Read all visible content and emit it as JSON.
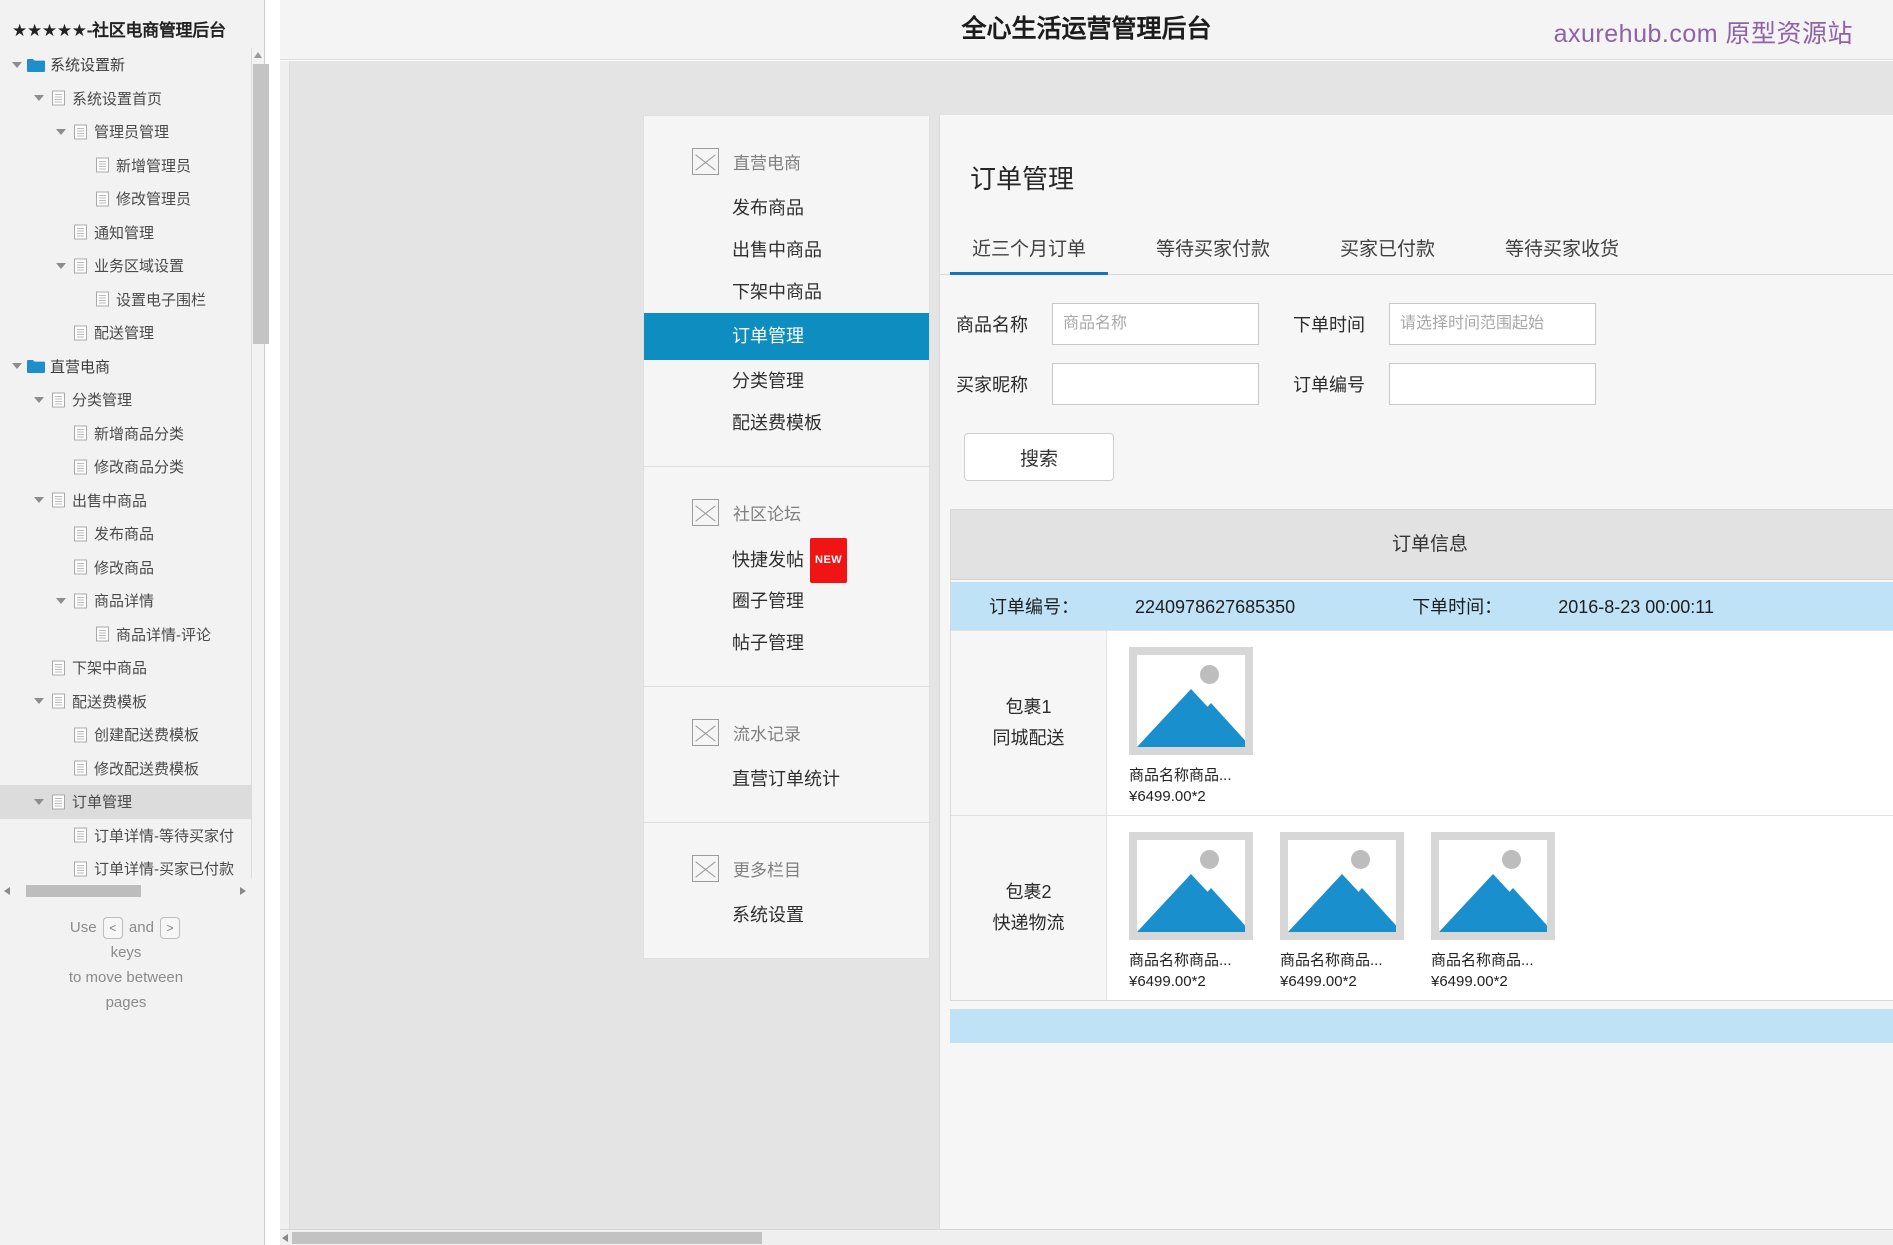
{
  "sitemap": {
    "title": "★★★★★-社区电商管理后台",
    "nodes": [
      {
        "label": "系统设置新",
        "depth": 0,
        "type": "folder",
        "caret": true
      },
      {
        "label": "系统设置首页",
        "depth": 1,
        "type": "page",
        "caret": true
      },
      {
        "label": "管理员管理",
        "depth": 2,
        "type": "page",
        "caret": true
      },
      {
        "label": "新增管理员",
        "depth": 3,
        "type": "page",
        "caret": false
      },
      {
        "label": "修改管理员",
        "depth": 3,
        "type": "page",
        "caret": false
      },
      {
        "label": "通知管理",
        "depth": 2,
        "type": "page",
        "caret": false
      },
      {
        "label": "业务区域设置",
        "depth": 2,
        "type": "page",
        "caret": true
      },
      {
        "label": "设置电子围栏",
        "depth": 3,
        "type": "page",
        "caret": false
      },
      {
        "label": "配送管理",
        "depth": 2,
        "type": "page",
        "caret": false
      },
      {
        "label": "直营电商",
        "depth": 0,
        "type": "folder",
        "caret": true
      },
      {
        "label": "分类管理",
        "depth": 1,
        "type": "page",
        "caret": true
      },
      {
        "label": "新增商品分类",
        "depth": 2,
        "type": "page",
        "caret": false
      },
      {
        "label": "修改商品分类",
        "depth": 2,
        "type": "page",
        "caret": false
      },
      {
        "label": "出售中商品",
        "depth": 1,
        "type": "page",
        "caret": true
      },
      {
        "label": "发布商品",
        "depth": 2,
        "type": "page",
        "caret": false
      },
      {
        "label": "修改商品",
        "depth": 2,
        "type": "page",
        "caret": false
      },
      {
        "label": "商品详情",
        "depth": 2,
        "type": "page",
        "caret": true
      },
      {
        "label": "商品详情-评论",
        "depth": 3,
        "type": "page",
        "caret": false
      },
      {
        "label": "下架中商品",
        "depth": 1,
        "type": "page",
        "caret": false
      },
      {
        "label": "配送费模板",
        "depth": 1,
        "type": "page",
        "caret": true
      },
      {
        "label": "创建配送费模板",
        "depth": 2,
        "type": "page",
        "caret": false
      },
      {
        "label": "修改配送费模板",
        "depth": 2,
        "type": "page",
        "caret": false
      },
      {
        "label": "订单管理",
        "depth": 1,
        "type": "page",
        "caret": true,
        "selected": true
      },
      {
        "label": "订单详情-等待买家付",
        "depth": 2,
        "type": "page",
        "caret": false
      },
      {
        "label": "订单详情-买家已付款",
        "depth": 2,
        "type": "page",
        "caret": false
      }
    ],
    "nav_hint": {
      "use": "Use",
      "key_prev": "<",
      "and": "and",
      "key_next": ">",
      "line2": "keys",
      "line3": "to move between",
      "line4": "pages"
    }
  },
  "topbar": {
    "title": "全心生活运营管理后台",
    "watermark": "axurehub.com 原型资源站"
  },
  "menu": {
    "groups": [
      {
        "head": "直营电商",
        "head_icon": "placeholder-image-icon",
        "items": [
          {
            "label": "发布商品",
            "active": false
          },
          {
            "label": "出售中商品",
            "active": false
          },
          {
            "label": "下架中商品",
            "active": false
          },
          {
            "label": "订单管理",
            "active": true
          },
          {
            "label": "分类管理",
            "active": false
          },
          {
            "label": "配送费模板",
            "active": false
          }
        ]
      },
      {
        "head": "社区论坛",
        "head_icon": "placeholder-image-icon",
        "items": [
          {
            "label": "快捷发帖",
            "active": false,
            "badge": "NEW"
          },
          {
            "label": "圈子管理",
            "active": false
          },
          {
            "label": "帖子管理",
            "active": false
          }
        ]
      },
      {
        "head": "流水记录",
        "head_icon": "placeholder-image-icon",
        "items": [
          {
            "label": "直营订单统计",
            "active": false
          }
        ]
      },
      {
        "head": "更多栏目",
        "head_icon": "placeholder-image-icon",
        "items": [
          {
            "label": "系统设置",
            "active": false
          }
        ]
      }
    ]
  },
  "order": {
    "title": "订单管理",
    "tabs": [
      {
        "label": "近三个月订单",
        "active": true
      },
      {
        "label": "等待买家付款",
        "active": false
      },
      {
        "label": "买家已付款",
        "active": false
      },
      {
        "label": "等待买家收货",
        "active": false
      }
    ],
    "form": {
      "product_name_label": "商品名称",
      "product_name_value": "",
      "product_name_placeholder": "商品名称",
      "order_time_label": "下单时间",
      "order_time_value": "",
      "order_time_placeholder": "请选择时间范围起始",
      "buyer_nickname_label": "买家昵称",
      "buyer_nickname_value": "",
      "buyer_nickname_placeholder": "",
      "order_number_label": "订单编号",
      "order_number_value": "",
      "order_number_placeholder": "",
      "search_button": "搜索"
    },
    "table": {
      "header": "订单信息",
      "order_no_label": "订单编号：",
      "order_no_value": "2240978627685350",
      "order_time_label": "下单时间：",
      "order_time_value": "2016-8-23 00:00:11",
      "packages": [
        {
          "name": "包裹1",
          "shipping": "同城配送",
          "products": [
            {
              "name": "商品名称商品...",
              "price": "¥6499.00*2"
            }
          ]
        },
        {
          "name": "包裹2",
          "shipping": "快递物流",
          "products": [
            {
              "name": "商品名称商品...",
              "price": "¥6499.00*2"
            },
            {
              "name": "商品名称商品...",
              "price": "¥6499.00*2"
            },
            {
              "name": "商品名称商品...",
              "price": "¥6499.00*2"
            }
          ]
        }
      ]
    }
  },
  "colors": {
    "accent_blue": "#0e8dc0",
    "tab_underline": "#1473c4",
    "badge_red": "#f01414",
    "row_highlight": "#bfe2f7",
    "watermark_purple": "#8d62a8"
  }
}
